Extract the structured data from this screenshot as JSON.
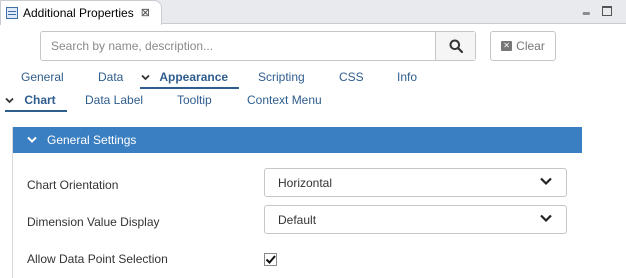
{
  "window": {
    "tab_title": "Additional Properties",
    "tab_close": "⊠",
    "minimize": "‗"
  },
  "search": {
    "placeholder": "Search by name, description...",
    "value": ""
  },
  "clear_button": {
    "label": "Clear"
  },
  "main_tabs": [
    {
      "label": "General",
      "active": false
    },
    {
      "label": "Data",
      "active": false
    },
    {
      "label": "Appearance",
      "active": true
    },
    {
      "label": "Scripting",
      "active": false
    },
    {
      "label": "CSS",
      "active": false
    },
    {
      "label": "Info",
      "active": false
    }
  ],
  "sub_tabs": [
    {
      "label": "Chart",
      "active": true
    },
    {
      "label": "Data Label",
      "active": false
    },
    {
      "label": "Tooltip",
      "active": false
    },
    {
      "label": "Context Menu",
      "active": false
    }
  ],
  "section": {
    "title": "General Settings",
    "properties": [
      {
        "label": "Chart Orientation",
        "value": "Horizontal"
      },
      {
        "label": "Dimension Value Display",
        "value": "Default"
      },
      {
        "label": "Allow Data Point Selection",
        "checked": true
      }
    ]
  },
  "colors": {
    "accent": "#3a7fc1",
    "link": "#2f5d8e"
  },
  "icons": {
    "view_tab": "properties-icon",
    "search": "search-icon",
    "clear": "clear-icon",
    "chevron": "chevron-down-icon"
  }
}
